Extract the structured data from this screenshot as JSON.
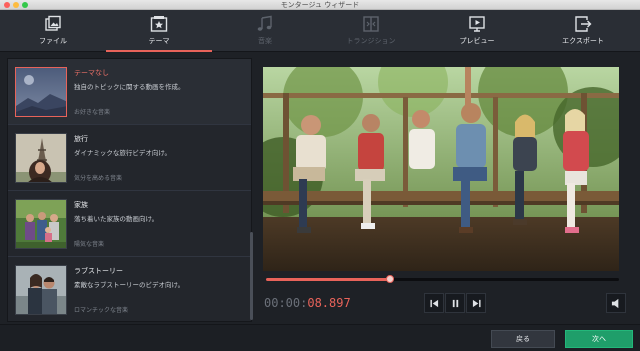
{
  "window": {
    "title": "モンタージュ ウィザード"
  },
  "tabs": [
    {
      "label": "ファイル",
      "icon": "file-image-icon",
      "state": "normal"
    },
    {
      "label": "テーマ",
      "icon": "theme-star-icon",
      "state": "active"
    },
    {
      "label": "音楽",
      "icon": "music-note-icon",
      "state": "disabled"
    },
    {
      "label": "トランジション",
      "icon": "transition-icon",
      "state": "disabled"
    },
    {
      "label": "プレビュー",
      "icon": "preview-play-icon",
      "state": "normal"
    },
    {
      "label": "エクスポート",
      "icon": "export-icon",
      "state": "normal"
    }
  ],
  "themes": [
    {
      "name": "テーマなし",
      "description": "独自のトピックに関する動画を作成。",
      "music": "お好きな音楽",
      "selected": true
    },
    {
      "name": "旅行",
      "description": "ダイナミックな旅行ビデオ向け。",
      "music": "気分を高める音楽",
      "selected": false
    },
    {
      "name": "家族",
      "description": "落ち着いた家族の動画向け。",
      "music": "陽気な音楽",
      "selected": false
    },
    {
      "name": "ラブストーリー",
      "description": "素敵なラブストーリーのビデオ向け。",
      "music": "ロマンチックな音楽",
      "selected": false
    }
  ],
  "player": {
    "timecode_elapsed": "00:00:",
    "timecode_frame": "08.897",
    "progress": 0.35
  },
  "footer": {
    "back_label": "戻る",
    "next_label": "次へ"
  },
  "colors": {
    "accent": "#e8635a",
    "next_button": "#1f9e6a",
    "background": "#1e2126"
  }
}
